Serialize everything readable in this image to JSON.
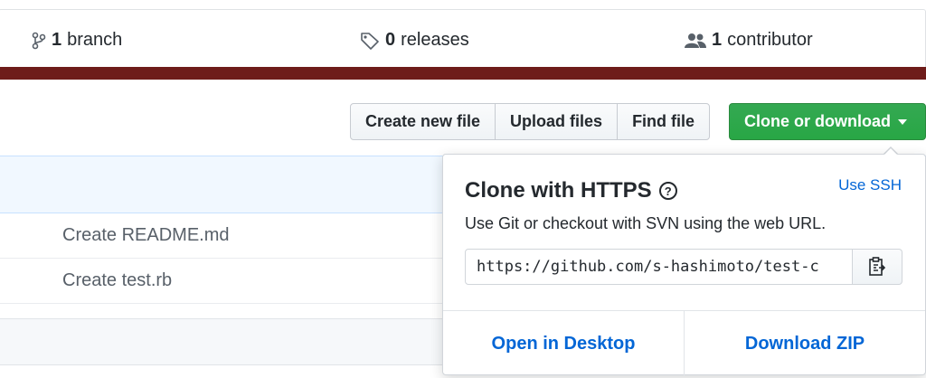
{
  "stats": {
    "branch": {
      "count": "1",
      "label": "branch",
      "icon": "branch-icon"
    },
    "releases": {
      "count": "0",
      "label": "releases",
      "icon": "tag-icon"
    },
    "contributors": {
      "count": "1",
      "label": "contributor",
      "icon": "people-icon"
    }
  },
  "toolbar": {
    "create_new_file": "Create new file",
    "upload_files": "Upload files",
    "find_file": "Find file",
    "clone_or_download": "Clone or download"
  },
  "files": [
    {
      "commit_message": "Create README.md"
    },
    {
      "commit_message": "Create test.rb"
    }
  ],
  "clone": {
    "title": "Clone with HTTPS",
    "use_ssh": "Use SSH",
    "description": "Use Git or checkout with SVN using the web URL.",
    "url": "https://github.com/s-hashimoto/test-c",
    "open_desktop": "Open in Desktop",
    "download_zip": "Download ZIP"
  },
  "colors": {
    "repo_bar": "#6e1c1a",
    "accent_green": "#28a745",
    "link_blue": "#0366d6"
  }
}
